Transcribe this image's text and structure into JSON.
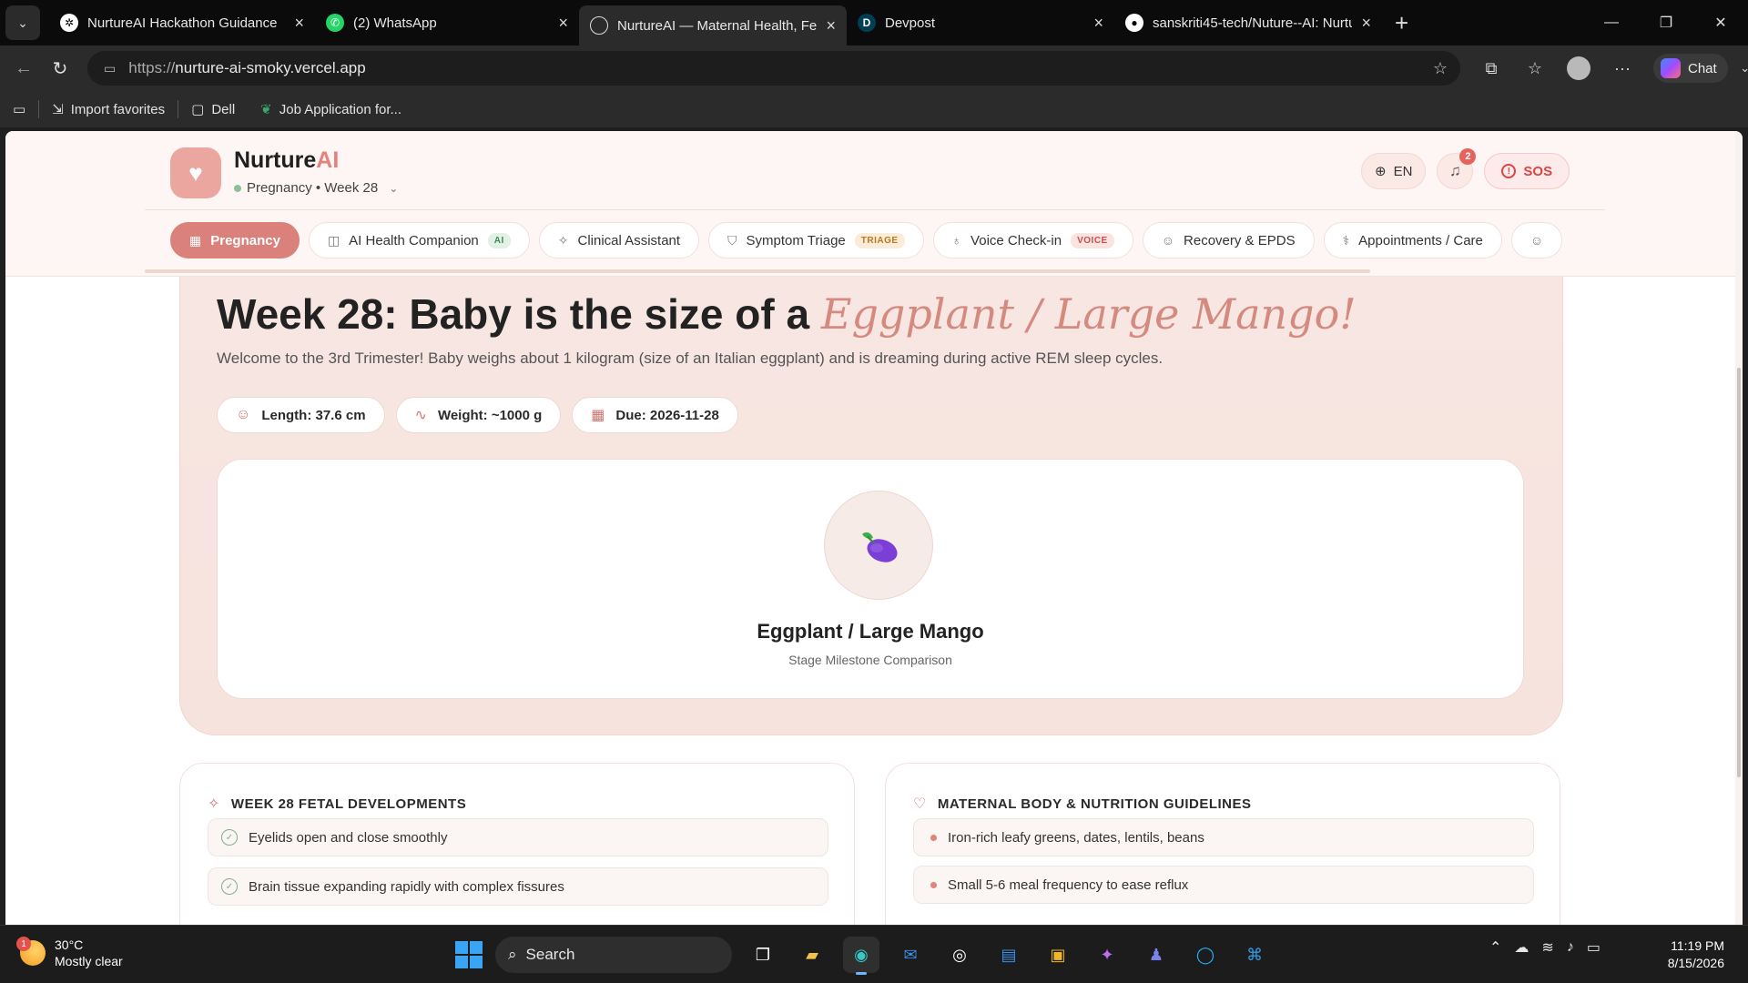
{
  "browser": {
    "tabs": [
      {
        "label": "NurtureAI Hackathon Guidance",
        "active": false
      },
      {
        "label": "(2) WhatsApp",
        "active": false
      },
      {
        "label": "NurtureAI — Maternal Health, Feta",
        "active": true
      },
      {
        "label": "Devpost",
        "active": false
      },
      {
        "label": "sanskriti45-tech/Nuture--AI: Nurtu",
        "active": false
      }
    ],
    "url_scheme": "https://",
    "url_host": "nurture-ai-smoky.vercel.app",
    "chat_label": "Chat",
    "favorites": [
      "Import favorites",
      "Dell",
      "Job Application for..."
    ]
  },
  "app": {
    "brand_main": "Nurture",
    "brand_accent": "AI",
    "stage": "Pregnancy • Week 28",
    "lang": "EN",
    "notif_count": "2",
    "sos": "SOS",
    "nav": [
      {
        "label": "Pregnancy",
        "tag": "",
        "active": true
      },
      {
        "label": "AI Health Companion",
        "tag": "AI",
        "active": false
      },
      {
        "label": "Clinical Assistant",
        "tag": "",
        "active": false
      },
      {
        "label": "Symptom Triage",
        "tag": "TRIAGE",
        "active": false
      },
      {
        "label": "Voice Check-in",
        "tag": "VOICE",
        "active": false
      },
      {
        "label": "Recovery & EPDS",
        "tag": "",
        "active": false
      },
      {
        "label": "Appointments / Care",
        "tag": "",
        "active": false
      }
    ]
  },
  "hero": {
    "title_prefix": "Week 28: Baby is the size of a ",
    "title_fruit": "Eggplant / Large Mango!",
    "subtitle": "Welcome to the 3rd Trimester! Baby weighs about 1 kilogram (size of an Italian eggplant) and is dreaming during active REM sleep cycles.",
    "chips": [
      "Length: 37.6 cm",
      "Weight: ~1000 g",
      "Due: 2026-11-28"
    ],
    "comparison_name": "Eggplant / Large Mango",
    "comparison_caption": "Stage Milestone Comparison"
  },
  "fetal": {
    "title": "WEEK 28 FETAL DEVELOPMENTS",
    "items": [
      "Eyelids open and close smoothly",
      "Brain tissue expanding rapidly with complex fissures"
    ]
  },
  "maternal": {
    "title": "MATERNAL BODY & NUTRITION GUIDELINES",
    "items": [
      "Iron-rich leafy greens, dates, lentils, beans",
      "Small 5-6 meal frequency to ease reflux"
    ]
  },
  "taskbar": {
    "weather_temp": "30°C",
    "weather_desc": "Mostly clear",
    "weather_badge": "1",
    "search": "Search",
    "time": "11:19 PM",
    "date": "8/15/2026"
  },
  "colors": {
    "accent": "#d9817a",
    "brand_accent": "#e3837b",
    "hero_bg": "#f7e6e2",
    "sos": "#d94640"
  }
}
